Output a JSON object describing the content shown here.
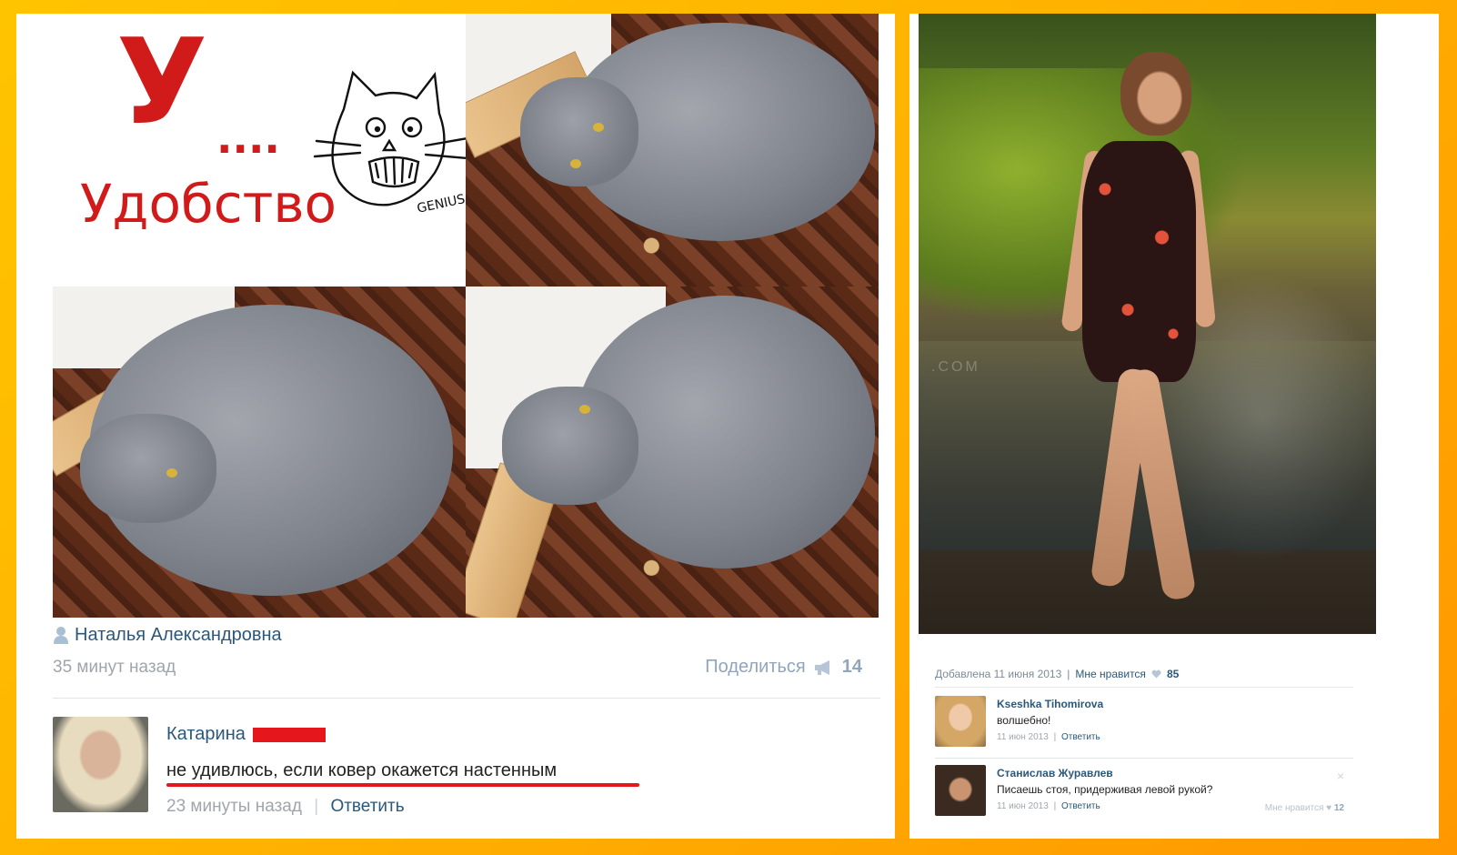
{
  "left_post": {
    "meme": {
      "letter": "У",
      "dots": "....",
      "word": "Удобство",
      "drawing_caption": "GENIUS"
    },
    "author": {
      "icon": "user-icon",
      "name": "Наталья Александровна"
    },
    "time": "35 минут назад",
    "share": {
      "label": "Поделиться",
      "icon": "megaphone-icon",
      "count": "14"
    },
    "comment": {
      "author": "Катарина",
      "text": "не удивлюсь, если ковер окажется настенным",
      "time": "23 минуты назад",
      "separator": "|",
      "reply": "Ответить"
    }
  },
  "right_post": {
    "watermark": ".COM",
    "meta": {
      "added": "Добавлена 11 июня 2013",
      "separator": "|",
      "likes_label": "Мне нравится",
      "heart_icon": "heart-icon",
      "likes_count": "85"
    },
    "comments": [
      {
        "name": "Kseshka Tihomirova",
        "text": "волшебно!",
        "date": "11 июн 2013",
        "separator": "|",
        "reply": "Ответить"
      },
      {
        "name": "Станислав Журавлев",
        "text": "Писаешь стоя, придерживая левой рукой?",
        "date": "11 июн 2013",
        "separator": "|",
        "reply": "Ответить",
        "like_label": "Мне нравится",
        "like_count": "12"
      }
    ]
  },
  "colors": {
    "frame": "#ffb300",
    "accent_red": "#d11a1a",
    "link_blue": "#2b587a",
    "muted_gray": "#a0a5ab"
  }
}
